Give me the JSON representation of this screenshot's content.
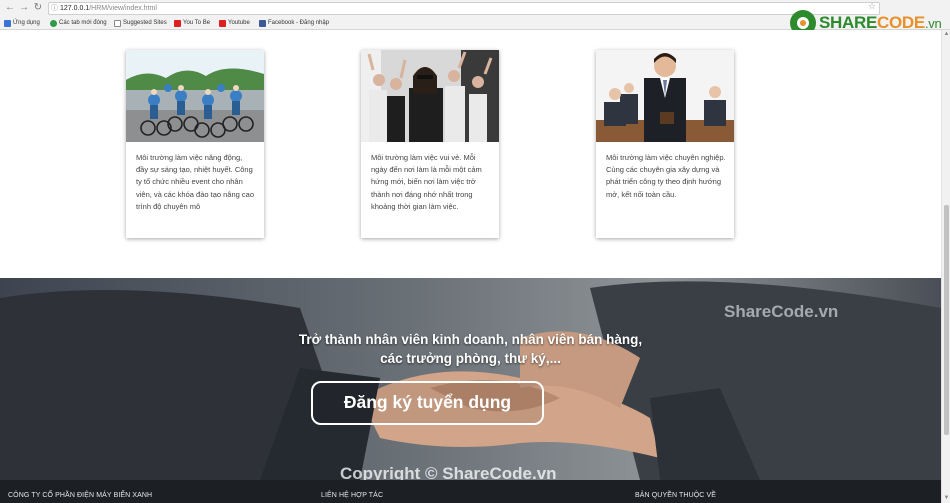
{
  "browser": {
    "url_host": "127.0.0.1",
    "url_path": "/HRM/view/index.html",
    "bookmarks": [
      {
        "label": "Ứng dụng",
        "color": "#3b73d6"
      },
      {
        "label": "Các tab mới đóng",
        "color": "#2f9b4a"
      },
      {
        "label": "Suggested Sites",
        "color": "#888888"
      },
      {
        "label": "You To Be",
        "color": "#e02020"
      },
      {
        "label": "Youtube",
        "color": "#e02020"
      },
      {
        "label": "Facebook - Đăng nhập",
        "color": "#3b5998"
      }
    ]
  },
  "logo": {
    "brand_a": "SHARE",
    "brand_b": "CODE",
    "brand_tld": ".vn"
  },
  "cards": [
    {
      "text": "Môi trường làm việc năng động, đầy sự sáng tạo, nhiệt huyết. Công ty tổ chức nhiều event cho nhân viên, và các khóa đào tạo nâng cao trình độ chuyên mô"
    },
    {
      "text": "Môi trường làm việc vui vẻ. Mỗi ngày đến nơi làm là mỗi một cảm hứng mới, biến nơi làm việc trở thành nơi đáng nhớ nhất trong khoảng thời gian làm việc."
    },
    {
      "text": "Môi trường làm việc chuyên nghiệp. Cùng các chuyên gia xây dựng và phát triển công ty theo định hướng mở, kết nối toàn cầu."
    }
  ],
  "hero": {
    "line1": "Trở thành nhân viên kinh doanh, nhân viên bán hàng,",
    "line2": "các trưởng phòng, thư ký,...",
    "button": "Đăng ký tuyển dụng",
    "watermark_right": "ShareCode.vn",
    "watermark_bottom": "Copyright © ShareCode.vn"
  },
  "footer": {
    "company": "CÔNG TY CỔ PHẦN ĐIỆN MÁY BIỂN XANH",
    "contact": "LIÊN HỆ HỢP TÁC",
    "copyright": "BẢN QUYỀN THUỘC VỀ"
  },
  "colors": {
    "brand_green": "#2d8a2d",
    "brand_orange": "#e8912a",
    "footer_bg": "#1c2024"
  }
}
